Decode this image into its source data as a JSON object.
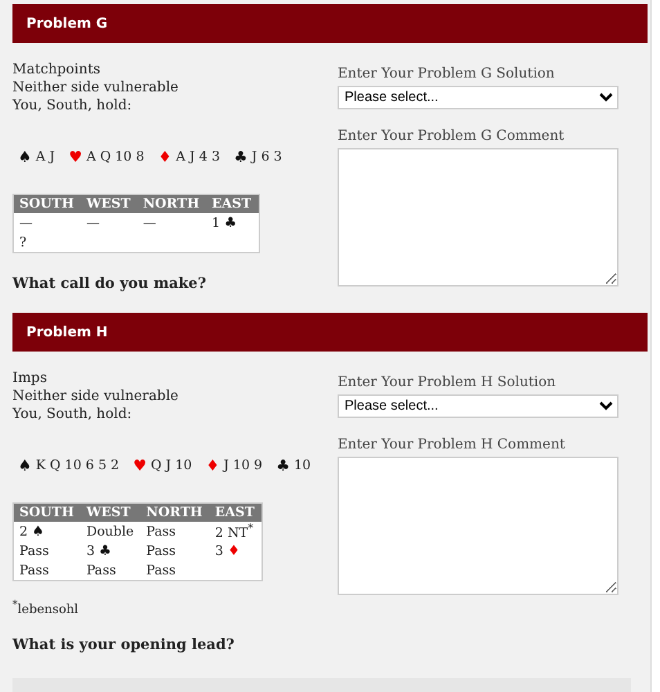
{
  "problems": [
    {
      "title": "Problem G",
      "conditions": [
        "Matchpoints",
        "Neither side vulnerable",
        "You, South, hold:"
      ],
      "hand": [
        {
          "kind": "spade",
          "symbol": "♠",
          "cards": "A J"
        },
        {
          "kind": "heart",
          "symbol": "♥",
          "cards": "A Q 10 8"
        },
        {
          "kind": "diamond",
          "symbol": "♦",
          "cards": "A J 4 3"
        },
        {
          "kind": "club",
          "symbol": "♣",
          "cards": "J 6 3"
        }
      ],
      "auction": {
        "columns": [
          "SOUTH",
          "WEST",
          "NORTH",
          "EAST"
        ],
        "rows": [
          [
            {
              "text": "—"
            },
            {
              "text": "—"
            },
            {
              "text": "—"
            },
            {
              "text": "1",
              "symbol": "♣",
              "kind": "club"
            }
          ],
          [
            {
              "text": "?"
            }
          ]
        ]
      },
      "question": "What call do you make?",
      "solution": {
        "label": "Enter Your Problem G Solution",
        "value": "Please select..."
      },
      "comment": {
        "label": "Enter Your Problem G Comment"
      }
    },
    {
      "title": "Problem H",
      "conditions": [
        "Imps",
        "Neither side vulnerable",
        "You, South, hold:"
      ],
      "hand": [
        {
          "kind": "spade",
          "symbol": "♠",
          "cards": "K Q 10 6 5 2"
        },
        {
          "kind": "heart",
          "symbol": "♥",
          "cards": "Q J 10"
        },
        {
          "kind": "diamond",
          "symbol": "♦",
          "cards": "J 10 9"
        },
        {
          "kind": "club",
          "symbol": "♣",
          "cards": "10"
        }
      ],
      "auction": {
        "columns": [
          "SOUTH",
          "WEST",
          "NORTH",
          "EAST"
        ],
        "rows": [
          [
            {
              "text": "2",
              "symbol": "♠",
              "kind": "spade"
            },
            {
              "text": "Double"
            },
            {
              "text": "Pass"
            },
            {
              "text": "2 NT$^{*}$"
            }
          ],
          [
            {
              "text": "Pass"
            },
            {
              "text": "3",
              "symbol": "♣",
              "kind": "club"
            },
            {
              "text": "Pass"
            },
            {
              "text": "3",
              "symbol": "♦",
              "kind": "diamond"
            }
          ],
          [
            {
              "text": "Pass"
            },
            {
              "text": "Pass"
            },
            {
              "text": "Pass"
            }
          ]
        ]
      },
      "footnote": "$^{*}$lebensohl",
      "question": "What is your opening lead?",
      "solution": {
        "label": "Enter Your Problem H Solution",
        "value": "Please select..."
      },
      "comment": {
        "label": "Enter Your Problem H Comment"
      }
    }
  ]
}
